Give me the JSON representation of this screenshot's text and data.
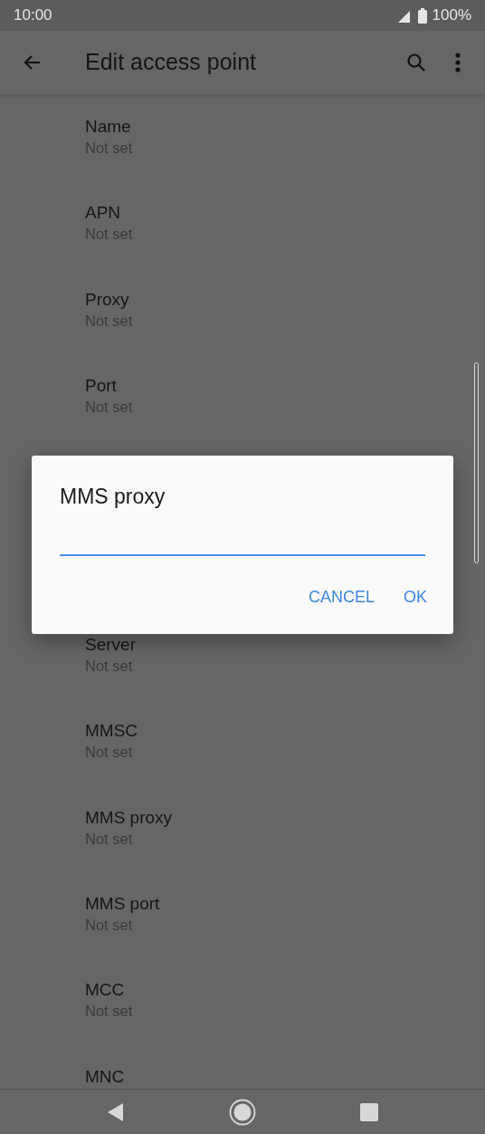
{
  "status_bar": {
    "time": "10:00",
    "battery": "100%"
  },
  "app_bar": {
    "title": "Edit access point"
  },
  "items": [
    {
      "title": "Name",
      "summary": "Not set"
    },
    {
      "title": "APN",
      "summary": "Not set"
    },
    {
      "title": "Proxy",
      "summary": "Not set"
    },
    {
      "title": "Port",
      "summary": "Not set"
    },
    {
      "title": "Server",
      "summary": "Not set"
    },
    {
      "title": "MMSC",
      "summary": "Not set"
    },
    {
      "title": "MMS proxy",
      "summary": "Not set"
    },
    {
      "title": "MMS port",
      "summary": "Not set"
    },
    {
      "title": "MCC",
      "summary": "Not set"
    },
    {
      "title": "MNC"
    }
  ],
  "dialog": {
    "title": "MMS proxy",
    "field_focused": true,
    "buttons": [
      "CANCEL",
      "OK"
    ]
  }
}
